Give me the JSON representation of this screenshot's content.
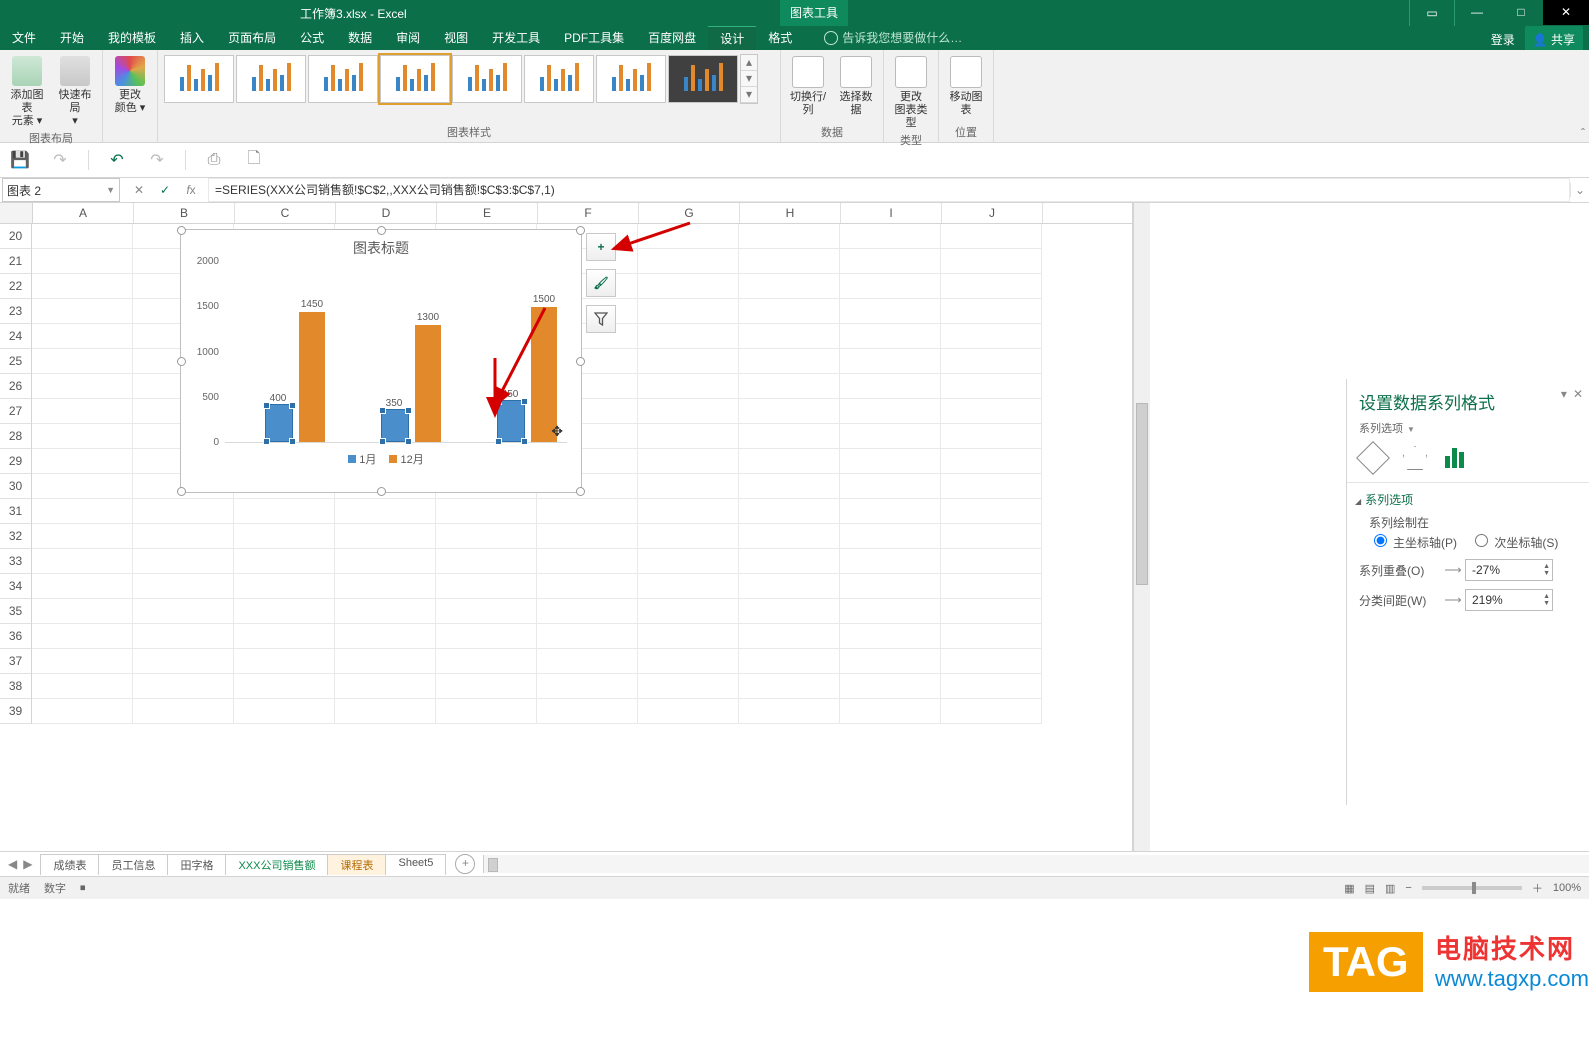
{
  "title": {
    "filename": "工作簿3.xlsx - Excel",
    "tooltab": "图表工具"
  },
  "window": {
    "login": "登录",
    "share": "共享"
  },
  "tabs": {
    "items": [
      "文件",
      "开始",
      "我的模板",
      "插入",
      "页面布局",
      "公式",
      "数据",
      "审阅",
      "视图",
      "开发工具",
      "PDF工具集",
      "百度网盘",
      "设计",
      "格式"
    ],
    "active_index": 12,
    "tellme": "告诉我您想要做什么…"
  },
  "ribbon": {
    "layout_group": "图表布局",
    "add_element": "添加图表\n元素 ▾",
    "quick_layout": "快速布局\n▾",
    "colors": "更改\n颜色 ▾",
    "styles_group": "图表样式",
    "switch_rc": "切换行/列",
    "select_data": "选择数据",
    "data_group": "数据",
    "change_type": "更改\n图表类型",
    "type_group": "类型",
    "move_chart": "移动图表",
    "location_group": "位置"
  },
  "qat": {
    "save": "💾",
    "undo": "↶",
    "redo": "↷",
    "print": "🖶",
    "preview": "🗋"
  },
  "namebox": "图表 2",
  "formula": "=SERIES(XXX公司销售额!$C$2,,XXX公司销售额!$C$3:$C$7,1)",
  "cols": [
    "A",
    "B",
    "C",
    "D",
    "E",
    "F",
    "G",
    "H",
    "I",
    "J"
  ],
  "rows_start": 20,
  "rows_end": 39,
  "chart_data": {
    "type": "bar",
    "title": "图表标题",
    "categories": [
      "",
      "",
      ""
    ],
    "series": [
      {
        "name": "1月",
        "values": [
          400,
          350,
          450
        ],
        "color": "#4a8ecb"
      },
      {
        "name": "12月",
        "values": [
          1450,
          1300,
          1500
        ],
        "color": "#e28a2b"
      }
    ],
    "ylim": [
      0,
      2000
    ],
    "yticks": [
      0,
      500,
      1000,
      1500,
      2000
    ],
    "data_labels": true
  },
  "chart_buttons": {
    "plus": "+",
    "brush": "🖌",
    "funnel": "⧩"
  },
  "pane": {
    "title": "设置数据系列格式",
    "subtitle": "系列选项",
    "section": "系列选项",
    "plot_on": "系列绘制在",
    "primary": "主坐标轴(P)",
    "secondary": "次坐标轴(S)",
    "overlap_label": "系列重叠(O)",
    "overlap_value": "-27%",
    "gap_label": "分类间距(W)",
    "gap_value": "219%"
  },
  "sheet_tabs": {
    "items": [
      "成绩表",
      "员工信息",
      "田字格",
      "XXX公司销售额",
      "课程表",
      "Sheet5"
    ],
    "active_index": 4
  },
  "status": {
    "ready": "就绪",
    "mode": "数字",
    "macro": "⏹",
    "zoom": "100%"
  },
  "watermark": {
    "tag": "TAG",
    "line1": "电脑技术网",
    "line2": "www.tagxp.com"
  }
}
